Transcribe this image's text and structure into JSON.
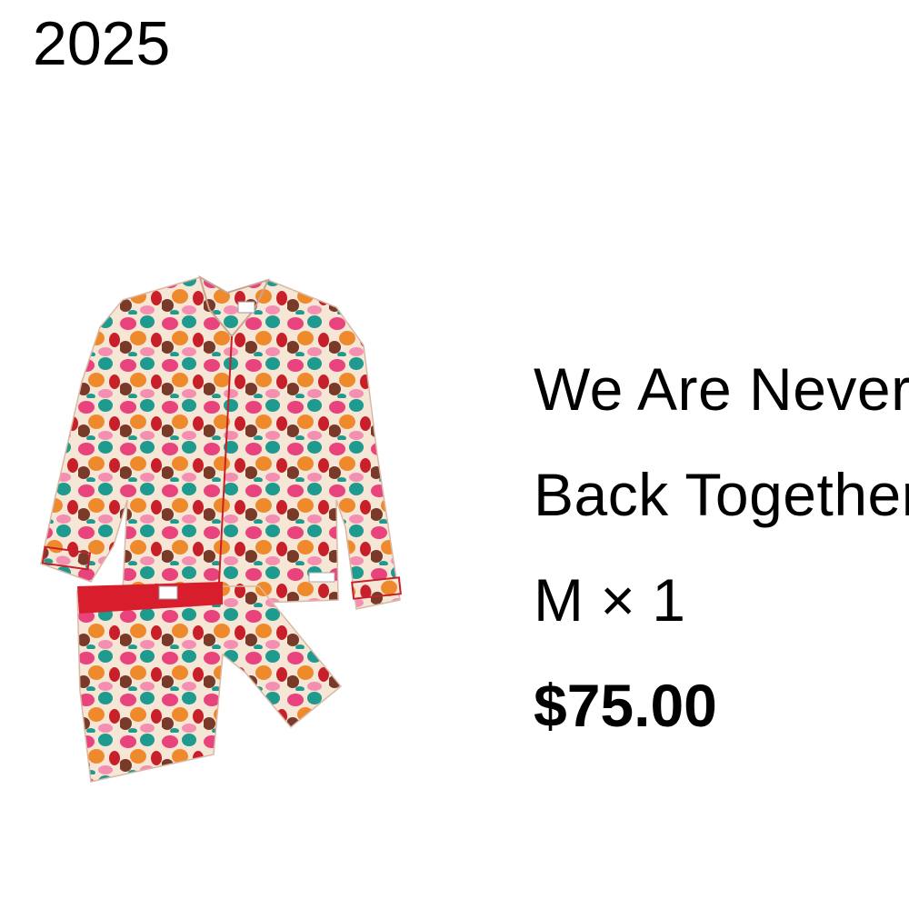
{
  "header": {
    "year": "2025"
  },
  "product": {
    "image_alt": "Patterned pajama set with long-sleeve shirt and shorts",
    "name_line_1": "We Are Never Ever",
    "name_line_2": "Back Together",
    "size": "M",
    "quantity_separator": "×",
    "quantity": "1",
    "price": "$75.00"
  },
  "colors": {
    "text": "#000000",
    "background": "#ffffff",
    "print_pink": "#e8437c",
    "print_teal": "#1e9a8f",
    "print_orange": "#ee8a2b",
    "print_red": "#c8202a",
    "print_brown": "#7a3a2a",
    "fabric_cream": "#f5e6d6",
    "waistband_red": "#d81e2c"
  }
}
